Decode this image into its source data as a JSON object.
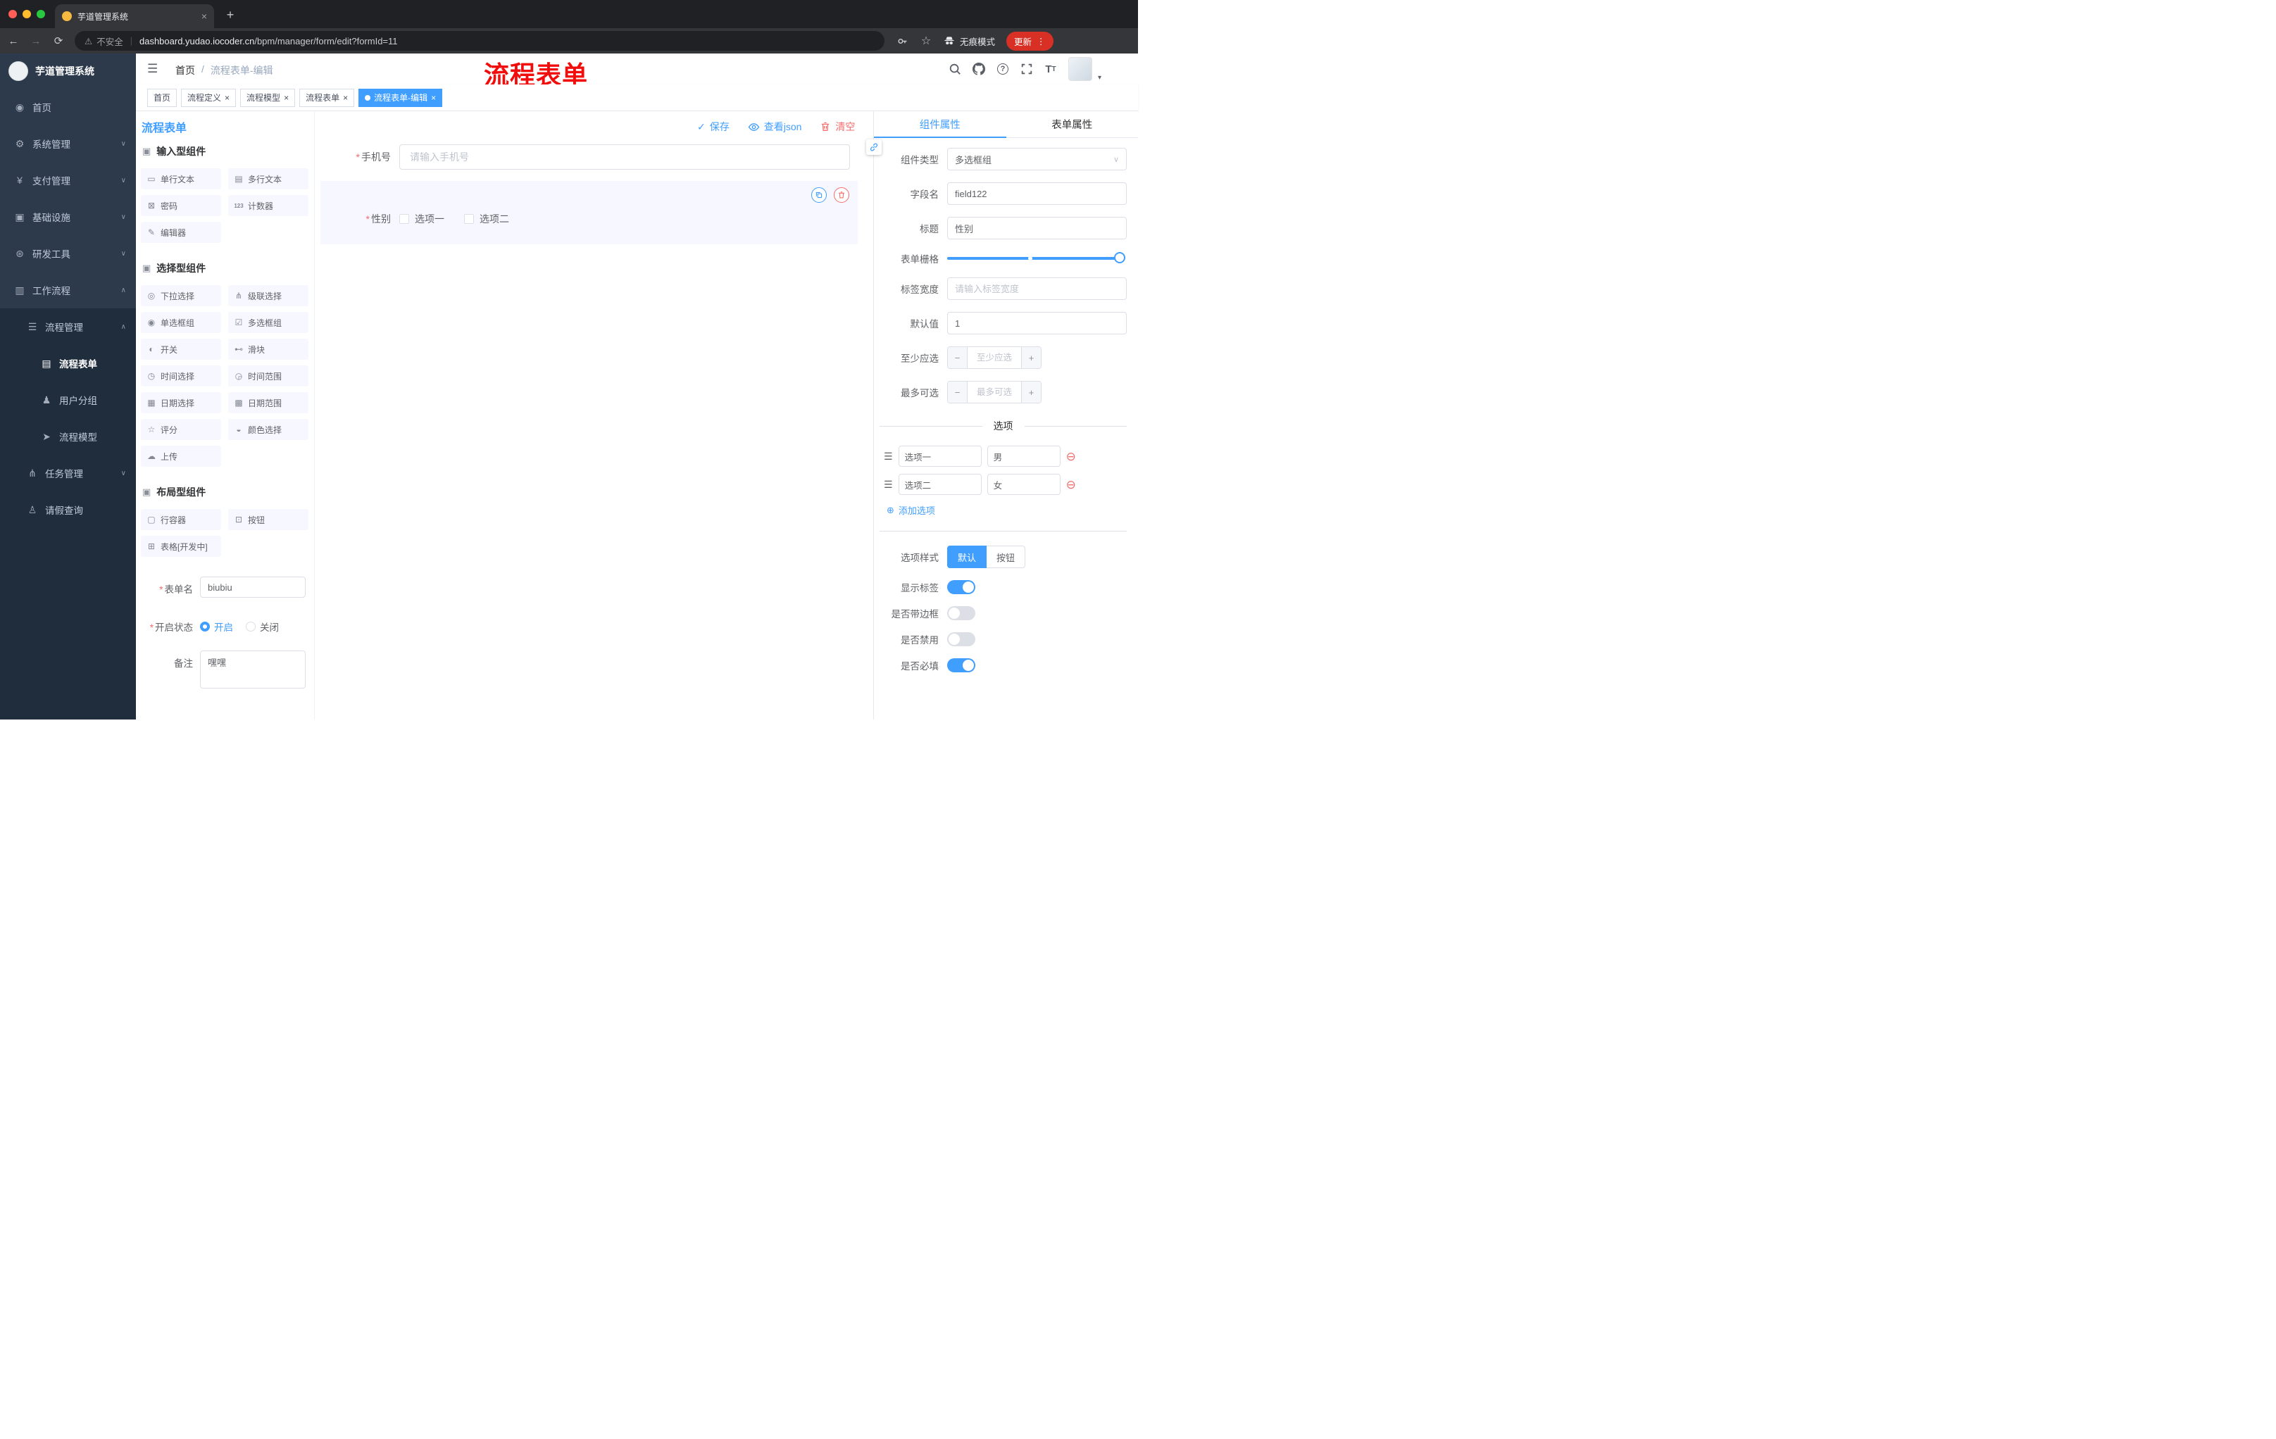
{
  "browser": {
    "tab_title": "芋道管理系统",
    "security_label": "不安全",
    "url_domain": "dashboard.yudao.iocoder.cn",
    "url_path": "/bpm/manager/form/edit?formId=11",
    "incognito_label": "无痕模式",
    "update_label": "更新"
  },
  "sidebar": {
    "logo_title": "芋道管理系统",
    "menu": [
      {
        "label": "首页",
        "icon": "◉"
      },
      {
        "label": "系统管理",
        "icon": "⚙",
        "chevron": "∨"
      },
      {
        "label": "支付管理",
        "icon": "¥",
        "chevron": "∨"
      },
      {
        "label": "基础设施",
        "icon": "▣",
        "chevron": "∨"
      },
      {
        "label": "研发工具",
        "icon": "⊛",
        "chevron": "∨"
      },
      {
        "label": "工作流程",
        "icon": "▥",
        "chevron": "∧"
      }
    ],
    "process_mgmt": {
      "label": "流程管理",
      "icon": "☰",
      "chevron": "∧"
    },
    "children": [
      {
        "label": "流程表单",
        "icon": "▤"
      },
      {
        "label": "用户分组",
        "icon": "♟"
      },
      {
        "label": "流程模型",
        "icon": "➤"
      }
    ],
    "menu_tail": [
      {
        "label": "任务管理",
        "icon": "⋔",
        "chevron": "∨"
      },
      {
        "label": "请假查询",
        "icon": "♙"
      }
    ]
  },
  "header": {
    "breadcrumb_home": "首页",
    "breadcrumb_sep": "/",
    "breadcrumb_current": "流程表单-编辑",
    "annotation": "流程表单",
    "font_icon_big": "T",
    "font_icon_small": "T"
  },
  "tags": [
    {
      "label": "首页"
    },
    {
      "label": "流程定义"
    },
    {
      "label": "流程模型"
    },
    {
      "label": "流程表单"
    },
    {
      "label": "流程表单-编辑"
    }
  ],
  "designer": {
    "title": "流程表单",
    "save_label": "保存",
    "view_json_label": "查看json",
    "clear_label": "清空",
    "sections": [
      {
        "title": "输入型组件",
        "items": [
          {
            "label": "单行文本",
            "icon": "▭"
          },
          {
            "label": "多行文本",
            "icon": "▤"
          },
          {
            "label": "密码",
            "icon": "⊠"
          },
          {
            "label": "计数器",
            "icon": "123"
          },
          {
            "label": "编辑器",
            "icon": "✎"
          }
        ]
      },
      {
        "title": "选择型组件",
        "items": [
          {
            "label": "下拉选择",
            "icon": "◎"
          },
          {
            "label": "级联选择",
            "icon": "⋔"
          },
          {
            "label": "单选框组",
            "icon": "◉"
          },
          {
            "label": "多选框组",
            "icon": "☑"
          },
          {
            "label": "开关",
            "icon": "◐"
          },
          {
            "label": "滑块",
            "icon": "⊷"
          },
          {
            "label": "时间选择",
            "icon": "◷"
          },
          {
            "label": "时间范围",
            "icon": "◶"
          },
          {
            "label": "日期选择",
            "icon": "▦"
          },
          {
            "label": "日期范围",
            "icon": "▩"
          },
          {
            "label": "评分",
            "icon": "☆"
          },
          {
            "label": "颜色选择",
            "icon": "◒"
          },
          {
            "label": "上传",
            "icon": "☁"
          }
        ]
      },
      {
        "title": "布局型组件",
        "items": [
          {
            "label": "行容器",
            "icon": "▢"
          },
          {
            "label": "按钮",
            "icon": "⊡"
          },
          {
            "label": "表格[开发中]",
            "icon": "⊞"
          }
        ]
      }
    ],
    "meta": {
      "name_label": "表单名",
      "name_value": "biubiu",
      "status_label": "开启状态",
      "status_on": "开启",
      "status_off": "关闭",
      "remark_label": "备注",
      "remark_value": "嘿嘿"
    },
    "canvas": {
      "phone_label": "手机号",
      "phone_placeholder": "请输入手机号",
      "gender_label": "性别",
      "option1": "选项一",
      "option2": "选项二"
    }
  },
  "props": {
    "tab_component": "组件属性",
    "tab_form": "表单属性",
    "type_label": "组件类型",
    "type_value": "多选框组",
    "field_label": "字段名",
    "field_value": "field122",
    "title_label": "标题",
    "title_value": "性别",
    "grid_label": "表单栅格",
    "width_label": "标签宽度",
    "width_placeholder": "请输入标签宽度",
    "default_label": "默认值",
    "default_value": "1",
    "min_label": "至少应选",
    "min_placeholder": "至少应选",
    "max_label": "最多可选",
    "max_placeholder": "最多可选",
    "options_title": "选项",
    "opt1_label": "选项一",
    "opt1_value": "男",
    "opt2_label": "选项二",
    "opt2_value": "女",
    "add_option": "添加选项",
    "style_label": "选项样式",
    "style_default": "默认",
    "style_button": "按钮",
    "show_label": "显示标签",
    "border_label": "是否带边框",
    "disabled_label": "是否禁用",
    "required_label": "是否必填"
  },
  "icons": {
    "hamburger": "☰",
    "chevron_down": "∨",
    "chevron_up": "∧",
    "caret_down": "▾",
    "back": "←",
    "forward": "→",
    "reload": "⟳",
    "warning": "⚠",
    "star": "☆",
    "dots": "⋮",
    "close": "×",
    "plus": "+",
    "minus": "−",
    "check": "✓",
    "add_circle": "⊕",
    "remove_circle": "⊖",
    "drag": "☰",
    "section": "▣",
    "question": "?",
    "required": "*",
    "new_tab": "+"
  },
  "colors": {
    "accent": "#409EFF",
    "danger": "#F56C6C",
    "annotation": "#F20D0D",
    "sidebar_bg": "#2D3A4B",
    "submenu_bg": "#1F2D3D",
    "update_pill": "#D93025"
  }
}
